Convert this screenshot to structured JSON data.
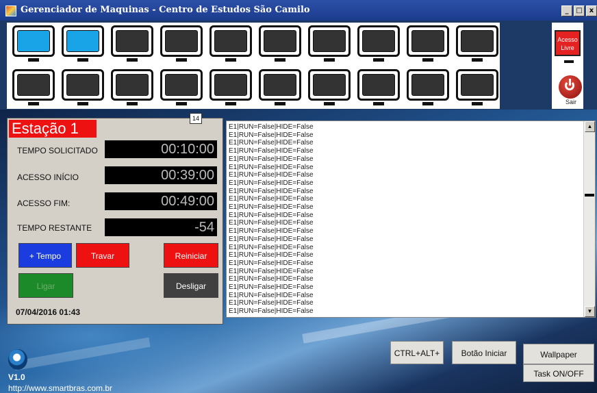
{
  "window": {
    "title": "Gerenciador de Maquinas  - Centro de Estudos São Camilo",
    "controls": [
      "_",
      "□",
      "x"
    ]
  },
  "monitors": {
    "row1": [
      {
        "state": "on"
      },
      {
        "state": "on"
      },
      {
        "state": "off"
      },
      {
        "state": "off"
      },
      {
        "state": "off"
      },
      {
        "state": "off"
      },
      {
        "state": "off"
      },
      {
        "state": "off"
      },
      {
        "state": "off"
      },
      {
        "state": "off"
      }
    ],
    "row2": [
      {
        "state": "off"
      },
      {
        "state": "off"
      },
      {
        "state": "off"
      },
      {
        "state": "off"
      },
      {
        "state": "off"
      },
      {
        "state": "off"
      },
      {
        "state": "off"
      },
      {
        "state": "off"
      },
      {
        "state": "off"
      },
      {
        "state": "off"
      }
    ],
    "colors": {
      "on": "#1aa4e8",
      "off": "#333333"
    }
  },
  "side": {
    "acesso_label": "Acesso Livre",
    "sair_label": "Sair"
  },
  "station": {
    "title": "Estação 1",
    "counter": "14",
    "fields": {
      "tempo_solicitado_label": "TEMPO SOLICITADO",
      "tempo_solicitado_value": "00:10:00",
      "acesso_inicio_label": "ACESSO INÍCIO",
      "acesso_inicio_value": "00:39:00",
      "acesso_fim_label": "ACESSO FIM:",
      "acesso_fim_value": "00:49:00",
      "tempo_restante_label": "TEMPO RESTANTE",
      "tempo_restante_value": "-54"
    },
    "buttons": {
      "mais_tempo": "+ Tempo",
      "travar": "Travar",
      "reiniciar": "Reiniciar",
      "ligar": "Ligar",
      "desligar": "Desligar"
    },
    "datetime": "07/04/2016 01:43"
  },
  "log": {
    "lines": [
      "E1|RUN=False|HIDE=False",
      "E1|RUN=False|HIDE=False",
      "E1|RUN=False|HIDE=False",
      "E1|RUN=False|HIDE=False",
      "E1|RUN=False|HIDE=False",
      "E1|RUN=False|HIDE=False",
      "E1|RUN=False|HIDE=False",
      "E1|RUN=False|HIDE=False",
      "E1|RUN=False|HIDE=False",
      "E1|RUN=False|HIDE=False",
      "E1|RUN=False|HIDE=False",
      "E1|RUN=False|HIDE=False",
      "E1|RUN=False|HIDE=False",
      "E1|RUN=False|HIDE=False",
      "E1|RUN=False|HIDE=False",
      "E1|RUN=False|HIDE=False",
      "E1|RUN=False|HIDE=False",
      "E1|RUN=False|HIDE=False",
      "E1|RUN=False|HIDE=False",
      "E1|RUN=False|HIDE=False",
      "E1|RUN=False|HIDE=False",
      "E1|RUN=False|HIDE=False",
      "E1|RUN=False|HIDE=False",
      "E1|RUN=False|HIDE=False"
    ]
  },
  "bottom": {
    "ctrl_alt": "CTRL+ALT+",
    "botao_iniciar": "Botão Iniciar",
    "wallpaper": "Wallpaper",
    "task": "Task ON/OFF",
    "version": "V1.0",
    "url": "http://www.smartbras.com.br"
  }
}
